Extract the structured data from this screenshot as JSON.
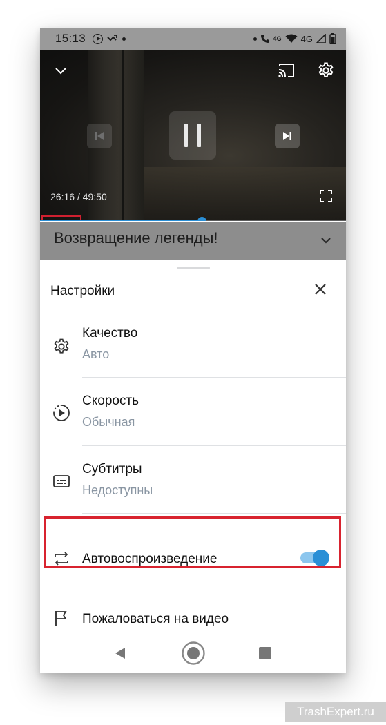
{
  "status_bar": {
    "time": "15:13",
    "network_tag_1": "4G",
    "network_tag_2": "4G"
  },
  "player": {
    "timecode": "26:16 / 49:50",
    "progress_fraction": 0.53,
    "title": "Возвращение легенды!"
  },
  "settings": {
    "title": "Настройки",
    "items": [
      {
        "label": "Качество",
        "value": "Авто",
        "icon": "gear-icon"
      },
      {
        "label": "Скорость",
        "value": "Обычная",
        "icon": "playback-speed-icon"
      },
      {
        "label": "Субтитры",
        "value": "Недоступны",
        "icon": "subtitles-icon"
      },
      {
        "label": "Автовоспроизведение",
        "icon": "repeat-icon",
        "toggle_on": true
      },
      {
        "label": "Пожаловаться на видео",
        "icon": "flag-icon"
      }
    ]
  },
  "colors": {
    "accent": "#2a8fd6",
    "highlight_border": "#d8232f",
    "secondary_text": "#8a96a3"
  },
  "watermark": "TrashExpert.ru"
}
